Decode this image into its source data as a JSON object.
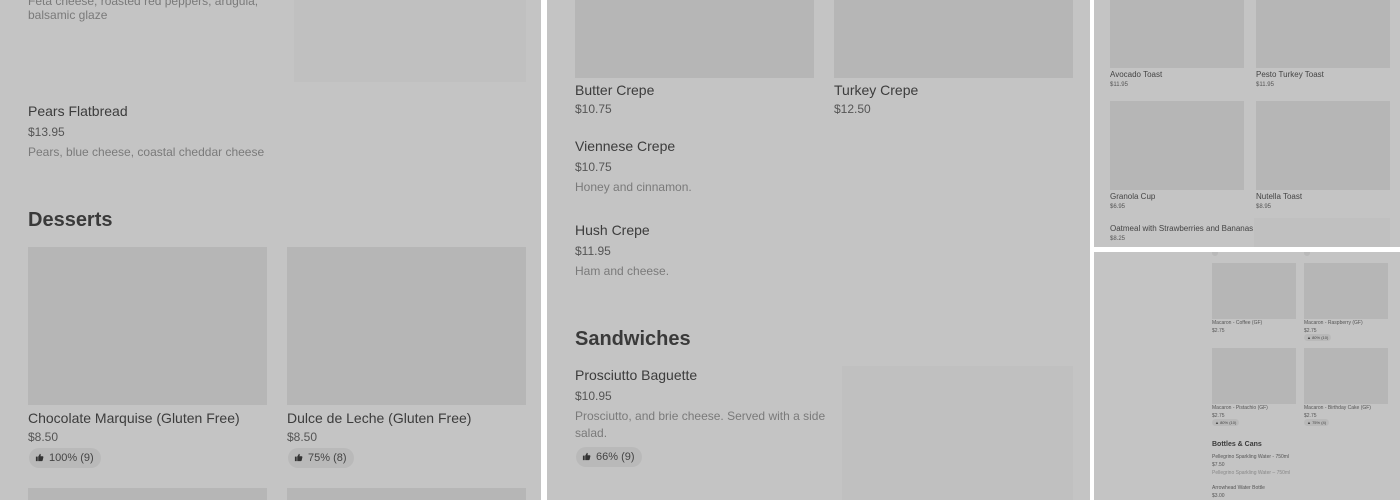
{
  "panel1": {
    "cut_description": "Feta cheese, roasted red peppers, arugula,",
    "cut_description_line2": "balsamic glaze",
    "pears": {
      "name": "Pears Flatbread",
      "price": "$13.95",
      "description": "Pears, blue cheese, coastal cheddar cheese"
    },
    "desserts_heading": "Desserts",
    "desserts": [
      {
        "name": "Chocolate Marquise (Gluten Free)",
        "price": "$8.50",
        "rating": "100% (9)"
      },
      {
        "name": "Dulce de Leche (Gluten Free)",
        "price": "$8.50",
        "rating": "75% (8)"
      }
    ]
  },
  "panel2": {
    "crepes_top": [
      {
        "name": "Butter Crepe",
        "price": "$10.75"
      },
      {
        "name": "Turkey Crepe",
        "price": "$12.50"
      }
    ],
    "viennese": {
      "name": "Viennese Crepe",
      "price": "$10.75",
      "description": "Honey and cinnamon."
    },
    "hush": {
      "name": "Hush Crepe",
      "price": "$11.95",
      "description": "Ham and cheese."
    },
    "sandwiches_heading": "Sandwiches",
    "prosciutto": {
      "name": "Prosciutto Baguette",
      "price": "$10.95",
      "description_line1": "Prosciutto, and brie cheese. Served with a side",
      "description_line2": "salad.",
      "rating": "66% (9)"
    }
  },
  "panel3": {
    "items": [
      {
        "name": "Avocado Toast",
        "price": "$11.95"
      },
      {
        "name": "Pesto Turkey Toast",
        "price": "$11.95"
      },
      {
        "name": "Granola Cup",
        "price": "$6.95"
      },
      {
        "name": "Nutella Toast",
        "price": "$8.95"
      }
    ],
    "oatmeal": {
      "name": "Oatmeal with Strawberries and Bananas",
      "price": "$8.25"
    }
  },
  "panel4": {
    "macarons": [
      {
        "name": "Macaron - Coffee (GF)",
        "price": "$2.75",
        "rating": ""
      },
      {
        "name": "Macaron - Raspberry (GF)",
        "price": "$2.75",
        "rating": "80% (10)"
      },
      {
        "name": "Macaron - Pistachio (GF)",
        "price": "$2.75",
        "rating": "80% (10)"
      },
      {
        "name": "Macaron - Birthday Cake (GF)",
        "price": "$2.75",
        "rating": "75% (4)"
      }
    ],
    "bottles_heading": "Bottles & Cans",
    "pellegrino": {
      "name": "Pellegrino Sparkling Water - 750ml",
      "price": "$7.50",
      "description": "Pellegrino Sparkling Water – 750ml"
    },
    "arrowhead": {
      "name": "Arrowhead Water Bottle",
      "price": "$3.00"
    }
  },
  "icons": {
    "rating": "thumbs-up-icon"
  }
}
